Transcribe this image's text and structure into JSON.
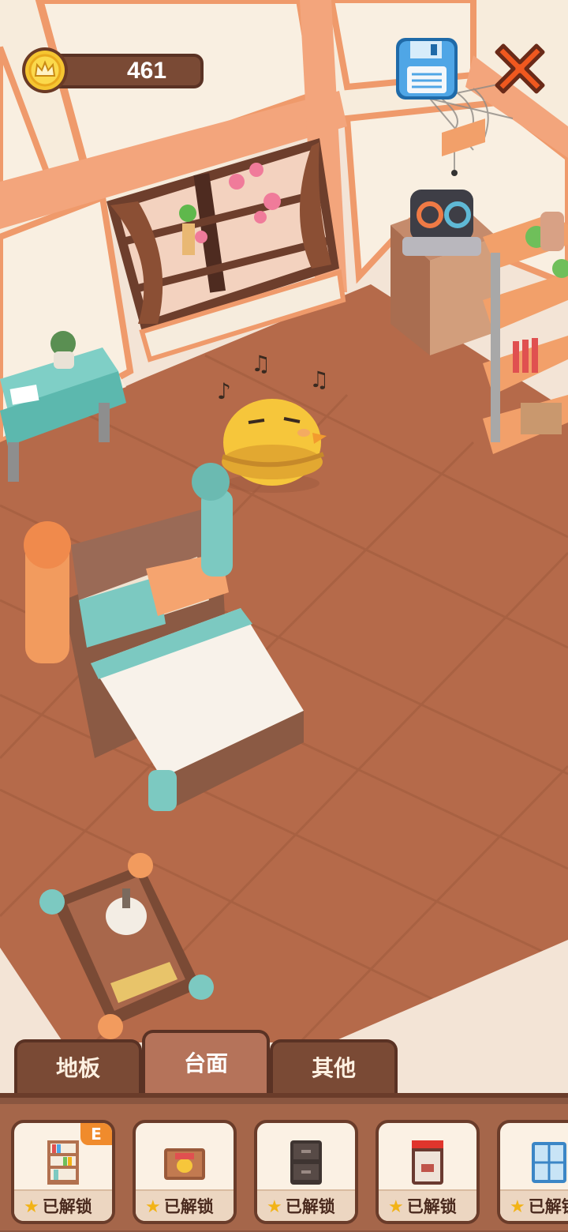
{
  "hud": {
    "coins": "461",
    "save_icon": "floppy-disk-icon",
    "close_icon": "close-x-icon",
    "coin_icon": "crown-coin-icon"
  },
  "tabs": [
    {
      "label": "地板",
      "active": false
    },
    {
      "label": "台面",
      "active": true
    },
    {
      "label": "其他",
      "active": false
    }
  ],
  "items": [
    {
      "icon": "bookshelf-icon",
      "label": "已解锁",
      "badge": "E"
    },
    {
      "icon": "crate-icon",
      "label": "已解锁"
    },
    {
      "icon": "dark-cabinet-icon",
      "label": "已解锁"
    },
    {
      "icon": "red-cabinet-icon",
      "label": "已解锁"
    },
    {
      "icon": "blue-window-icon",
      "label": "已解锁"
    }
  ],
  "colors": {
    "floor": "#b56a4a",
    "wall": "#f6ecdd",
    "accent_orange": "#ef9a6b",
    "accent_teal": "#79c7c0",
    "panel": "#8a5640"
  }
}
